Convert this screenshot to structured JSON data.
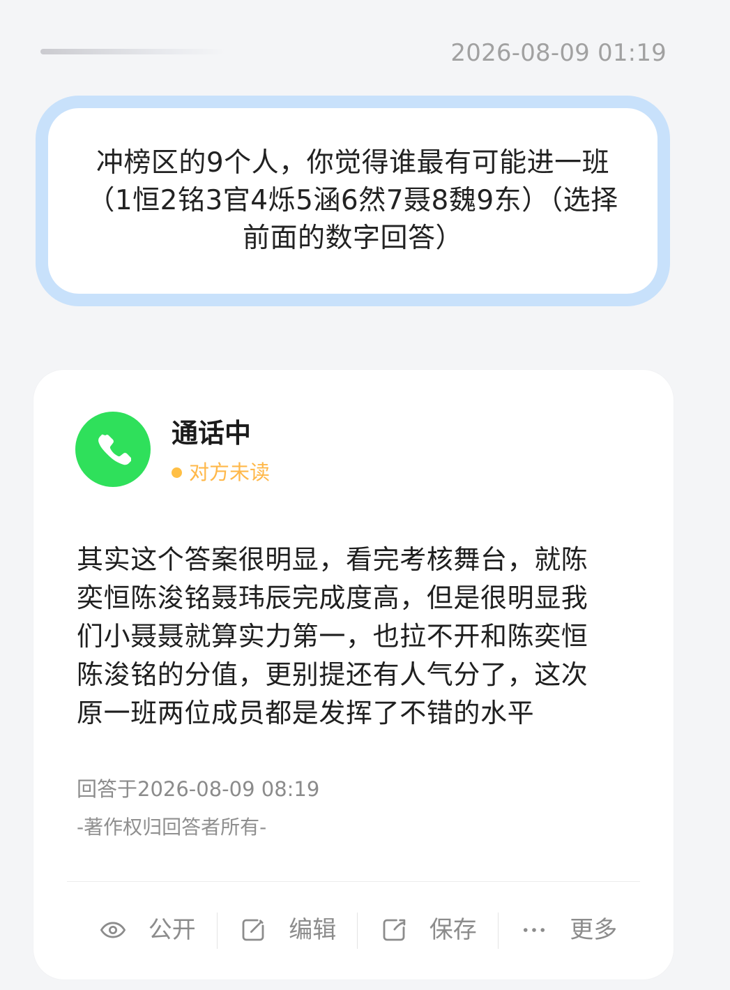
{
  "header": {
    "timestamp": "2026-08-09 01:19"
  },
  "question": {
    "text": "冲榜区的9个人，你觉得谁最有可能进一班\n（1恒2铭3官4烁5涵6然7聂8魏9东）（选择\n前面的数字回答）"
  },
  "answer": {
    "status_title": "通话中",
    "read_status": "对方未读",
    "body": "其实这个答案很明显，看完考核舞台，就陈\n奕恒陈浚铭聂玮辰完成度高，但是很明显我\n们小聂聂就算实力第一，也拉不开和陈奕恒\n陈浚铭的分值，更别提还有人气分了，这次\n原一班两位成员都是发挥了不错的水平",
    "answered_at": "回答于2026-08-09 08:19",
    "copyright": "-著作权归回答者所有-"
  },
  "actions": [
    {
      "label": "公开",
      "icon": "eye-icon"
    },
    {
      "label": "编辑",
      "icon": "edit-icon"
    },
    {
      "label": "保存",
      "icon": "share-icon"
    },
    {
      "label": "更多",
      "icon": "more-icon"
    }
  ],
  "colors": {
    "background": "#f4f5f7",
    "question_border": "#c8e1fb",
    "avatar_green": "#2fe05b",
    "unread_orange": "#ffb84a",
    "muted_text": "#8c8c8c"
  }
}
